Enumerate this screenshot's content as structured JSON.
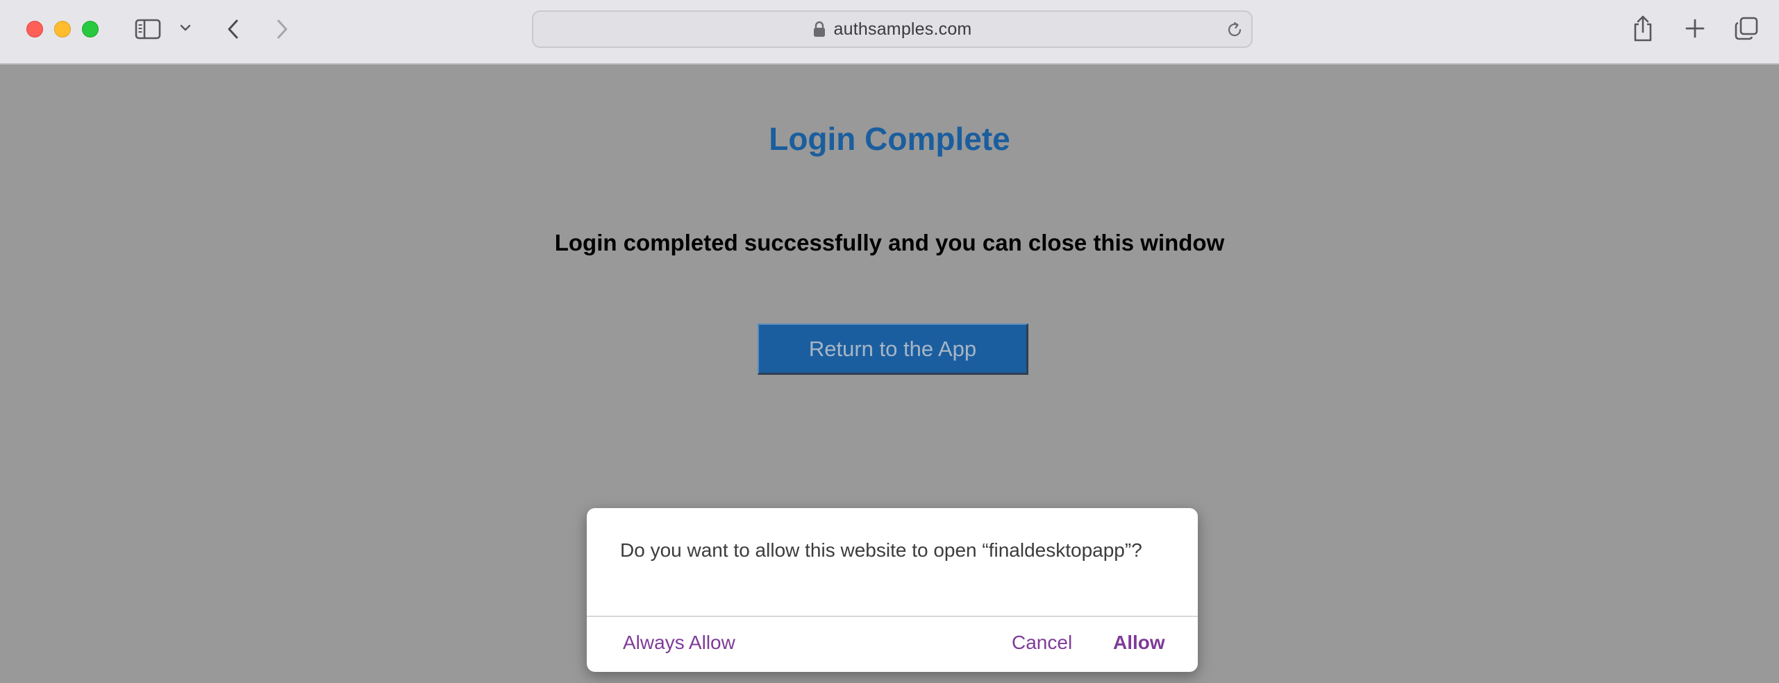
{
  "browser": {
    "address_bar": {
      "url": "authsamples.com"
    },
    "icons": {
      "sidebar": "sidebar-icon",
      "tab_group_menu": "chevron-down-icon",
      "back": "chevron-left-icon",
      "forward": "chevron-right-icon",
      "lock": "lock-icon",
      "reload": "reload-icon",
      "share": "share-icon",
      "new_tab": "plus-icon",
      "tab_overview": "tabs-overview-icon"
    }
  },
  "page": {
    "title": "Login Complete",
    "message": "Login completed successfully and you can close this window",
    "return_button_label": "Return to the App",
    "title_color": "#1a5e9e",
    "button_color": "#1b5e9f"
  },
  "dialog": {
    "message": "Do you want to allow this website to open “finaldesktopapp”?",
    "always_allow_label": "Always Allow",
    "cancel_label": "Cancel",
    "allow_label": "Allow",
    "button_color": "#7e3b98"
  }
}
